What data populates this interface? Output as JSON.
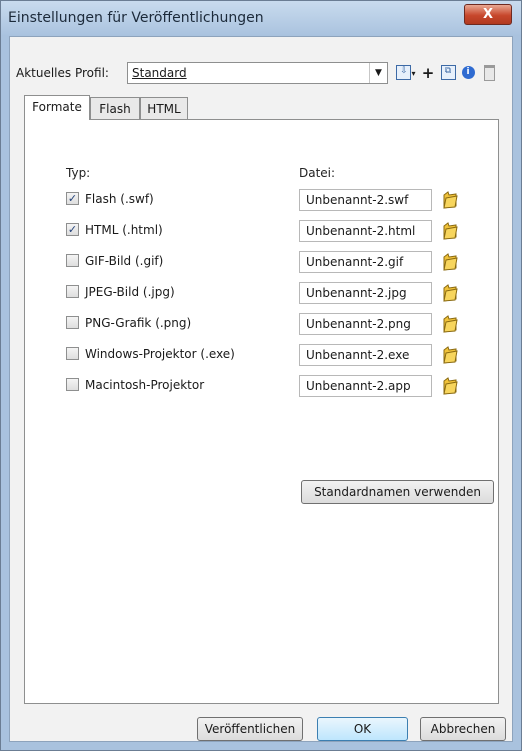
{
  "window": {
    "title": "Einstellungen für Veröffentlichungen",
    "close": "X"
  },
  "profile": {
    "label": "Aktuelles Profil:",
    "value": "Standard"
  },
  "tabs": [
    {
      "label": "Formate",
      "active": true
    },
    {
      "label": "Flash",
      "active": false
    },
    {
      "label": "HTML",
      "active": false
    }
  ],
  "formats": {
    "type_header": "Typ:",
    "file_header": "Datei:",
    "rows": [
      {
        "label": "Flash  (.swf)",
        "checked": true,
        "file": "Unbenannt-2.swf"
      },
      {
        "label": "HTML  (.html)",
        "checked": true,
        "file": "Unbenannt-2.html"
      },
      {
        "label": "GIF-Bild  (.gif)",
        "checked": false,
        "file": "Unbenannt-2.gif"
      },
      {
        "label": "JPEG-Bild  (.jpg)",
        "checked": false,
        "file": "Unbenannt-2.jpg"
      },
      {
        "label": "PNG-Grafik  (.png)",
        "checked": false,
        "file": "Unbenannt-2.png"
      },
      {
        "label": "Windows-Projektor  (.exe)",
        "checked": false,
        "file": "Unbenannt-2.exe"
      },
      {
        "label": "Macintosh-Projektor",
        "checked": false,
        "file": "Unbenannt-2.app"
      }
    ],
    "default_names_button": "Standardnamen verwenden"
  },
  "buttons": {
    "publish": "Veröffentlichen",
    "ok": "OK",
    "cancel": "Abbrechen"
  },
  "colors": {
    "titlebar": "#aac3df",
    "close": "#c7472c",
    "folder": "#e9b92b"
  }
}
